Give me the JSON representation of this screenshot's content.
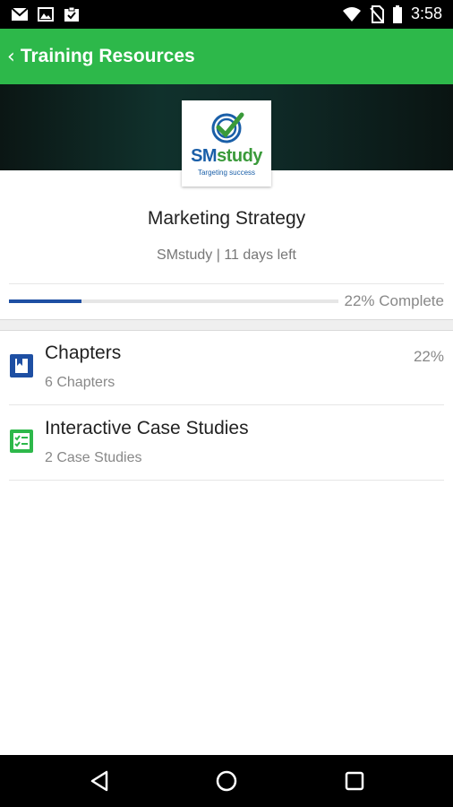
{
  "status_bar": {
    "time": "3:58",
    "left_icons": [
      "gmail-icon",
      "image-icon",
      "clipboard-icon"
    ],
    "right_icons": [
      "wifi-icon",
      "no-sim-icon",
      "battery-icon"
    ]
  },
  "app_bar": {
    "back_icon": "chevron-left-icon",
    "title": "Training Resources",
    "color": "#2db84a"
  },
  "course": {
    "logo": {
      "name_part1": "SM",
      "name_part2": "study",
      "tagline": "Targeting success"
    },
    "title": "Marketing Strategy",
    "subtitle": "SMstudy | 11 days left",
    "progress_percent": 22,
    "progress_label": "22% Complete",
    "progress_color": "#1e4fa3"
  },
  "items": [
    {
      "icon": "book-icon",
      "title": "Chapters",
      "subtitle": "6 Chapters",
      "percent": "22%",
      "icon_color": "#1e4fa3"
    },
    {
      "icon": "checklist-icon",
      "title": "Interactive Case Studies",
      "subtitle": "2 Case Studies",
      "percent": "",
      "icon_color": "#2db84a"
    }
  ],
  "nav_bar": {
    "buttons": [
      "back-triangle-icon",
      "home-circle-icon",
      "recents-square-icon"
    ]
  }
}
